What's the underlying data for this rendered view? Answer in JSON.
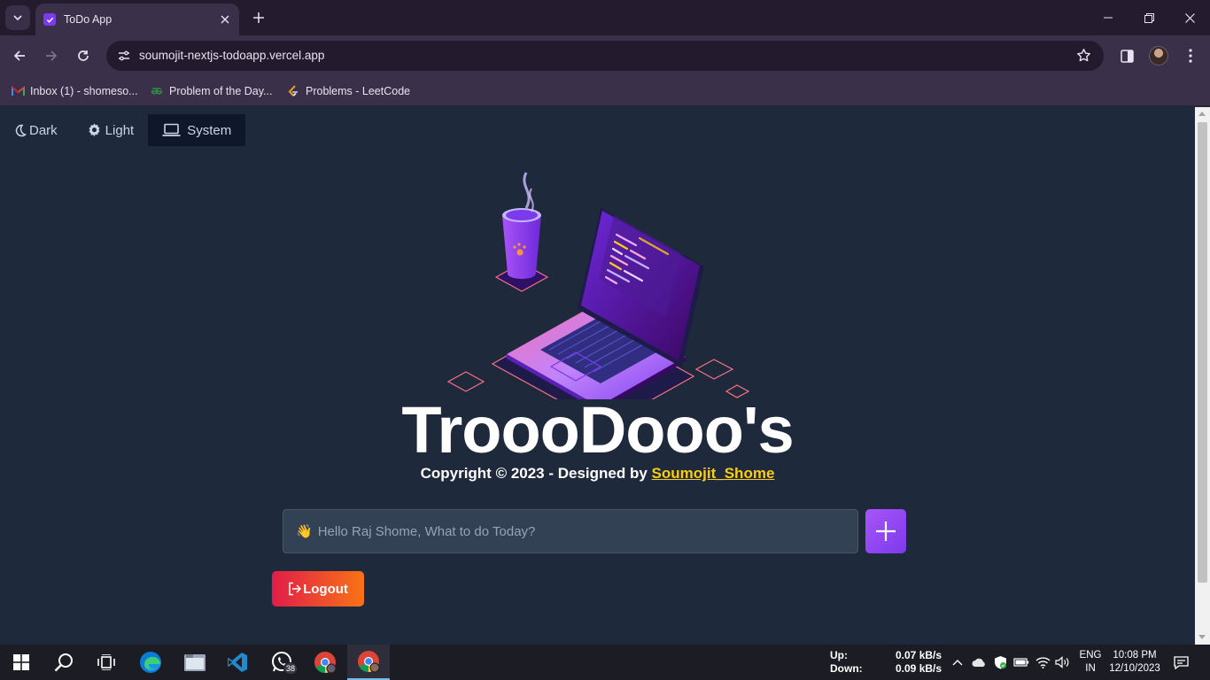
{
  "browser": {
    "tab_title": "ToDo App",
    "url": "soumojit-nextjs-todoapp.vercel.app",
    "bookmarks": [
      {
        "label": "Inbox (1) - shomeso...",
        "icon": "gmail-icon"
      },
      {
        "label": "Problem of the Day...",
        "icon": "gfg-icon"
      },
      {
        "label": "Problems - LeetCode",
        "icon": "leetcode-icon"
      }
    ]
  },
  "theme": {
    "options": [
      {
        "label": "Dark",
        "icon": "moon-icon"
      },
      {
        "label": "Light",
        "icon": "gear-icon"
      },
      {
        "label": "System",
        "icon": "laptop-icon"
      }
    ],
    "selected": "System"
  },
  "app": {
    "brand": "TroooDooo's",
    "copyright_prefix": "Copyright © 2023 - Designed by ",
    "author": "Soumojit_Shome",
    "input_placeholder": "Hello Raj Shome, What to do Today?",
    "wave_emoji": "👋",
    "logout_label": "Logout"
  },
  "taskbar": {
    "apps": [
      "windows-start",
      "search",
      "task-view",
      "edge",
      "file-explorer",
      "vscode",
      "whatsapp",
      "chrome-profile",
      "chrome"
    ],
    "whatsapp_badge": "38",
    "net_up_label": "Up:",
    "net_down_label": "Down:",
    "net_up_value": "0.07 kB/s",
    "net_down_value": "0.09 kB/s",
    "lang_line1": "ENG",
    "lang_line2": "IN",
    "time": "10:08 PM",
    "date": "12/10/2023"
  },
  "colors": {
    "page_bg": "#1e293b",
    "accent_purple": "#7c3aed",
    "author_yellow": "#facc15",
    "logout_start": "#e11d48",
    "logout_end": "#f97316"
  }
}
